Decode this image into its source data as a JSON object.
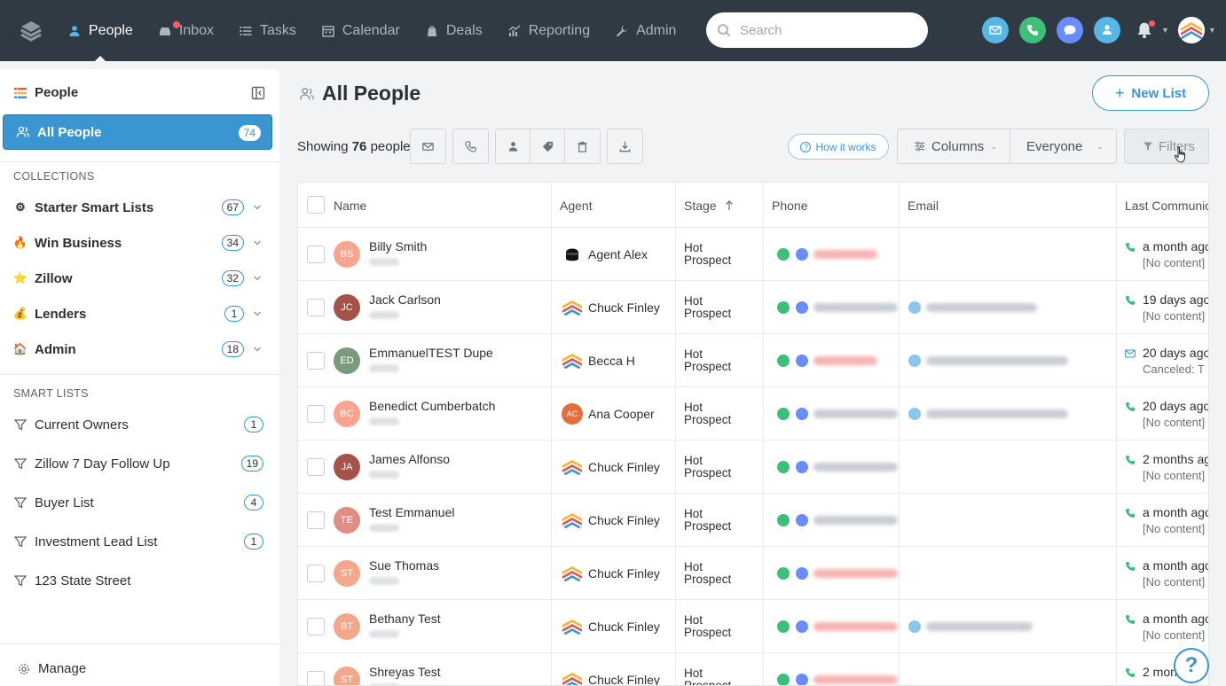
{
  "nav": {
    "items": [
      {
        "label": "People",
        "icon": "people-icon",
        "active": true
      },
      {
        "label": "Inbox",
        "icon": "inbox-icon",
        "active": false,
        "dot": true
      },
      {
        "label": "Tasks",
        "icon": "tasks-icon",
        "active": false
      },
      {
        "label": "Calendar",
        "icon": "calendar-icon",
        "active": false
      },
      {
        "label": "Deals",
        "icon": "deals-icon",
        "active": false
      },
      {
        "label": "Reporting",
        "icon": "reporting-icon",
        "active": false
      },
      {
        "label": "Admin",
        "icon": "wrench-icon",
        "active": false
      }
    ],
    "search_placeholder": "Search"
  },
  "sidebar": {
    "title": "People",
    "all_people": {
      "label": "All People",
      "count": "74"
    },
    "collections_heading": "COLLECTIONS",
    "collections": [
      {
        "label": "Starter Smart Lists",
        "count": "67",
        "emoji": "⚙"
      },
      {
        "label": "Win Business",
        "count": "34",
        "emoji": "🔥"
      },
      {
        "label": "Zillow",
        "count": "32",
        "emoji": "⭐"
      },
      {
        "label": "Lenders",
        "count": "1",
        "emoji": "💰"
      },
      {
        "label": "Admin",
        "count": "18",
        "emoji": "🏠"
      }
    ],
    "smart_lists_heading": "SMART LISTS",
    "smart_lists": [
      {
        "label": "Current Owners",
        "count": "1"
      },
      {
        "label": "Zillow 7 Day Follow Up",
        "count": "19"
      },
      {
        "label": "Buyer List",
        "count": "4"
      },
      {
        "label": "Investment Lead List",
        "count": "1"
      },
      {
        "label": "123 State Street",
        "count": ""
      }
    ],
    "manage_label": "Manage"
  },
  "main": {
    "title": "All People",
    "new_list_label": "New List",
    "showing_prefix": "Showing",
    "showing_count": "76",
    "showing_suffix": "people",
    "how_it_works": "How it works",
    "columns_label": "Columns",
    "everyone_label": "Everyone",
    "filters_label": "Filters",
    "help_label": "?"
  },
  "table": {
    "headers": {
      "name": "Name",
      "agent": "Agent",
      "stage": "Stage",
      "phone": "Phone",
      "email": "Email",
      "last": "Last Communic"
    },
    "rows": [
      {
        "initials": "BS",
        "name": "Billy Smith",
        "avatar_color": "#f7a58f",
        "agent": "Agent Alex",
        "agent_type": "dark",
        "stage1": "Hot",
        "stage2": "Prospect",
        "phone_color": "#f7b3b3",
        "phone_w": 72,
        "email": false,
        "lc_type": "phone",
        "lc_main": "a month ago",
        "lc_sub": "[No content]"
      },
      {
        "initials": "JC",
        "name": "Jack Carlson",
        "avatar_color": "#a5524b",
        "agent": "Chuck Finley",
        "agent_type": "logo",
        "stage1": "Hot",
        "stage2": "Prospect",
        "phone_color": "#c9cdd1",
        "phone_w": 95,
        "email": true,
        "email_w": 125,
        "lc_type": "phone",
        "lc_main": "19 days ago",
        "lc_sub": "[No content]"
      },
      {
        "initials": "ED",
        "name": "EmmanuelTEST Dupe",
        "avatar_color": "#7b9a7b",
        "agent": "Becca H",
        "agent_type": "logo",
        "stage1": "Hot",
        "stage2": "Prospect",
        "phone_color": "#f7b3b3",
        "phone_w": 72,
        "email": true,
        "email_w": 160,
        "lc_type": "email",
        "lc_main": "20 days ago",
        "lc_sub": "Canceled: T"
      },
      {
        "initials": "BC",
        "name": "Benedict Cumberbatch",
        "avatar_color": "#f7a58f",
        "agent": "Ana Cooper",
        "agent_type": "initials",
        "agent_initials": "AC",
        "stage1": "Hot",
        "stage2": "Prospect",
        "phone_color": "#c9cdd1",
        "phone_w": 95,
        "email": true,
        "email_w": 160,
        "lc_type": "phone",
        "lc_main": "20 days ago",
        "lc_sub": "[No content]"
      },
      {
        "initials": "JA",
        "name": "James Alfonso",
        "avatar_color": "#a5524b",
        "agent": "Chuck Finley",
        "agent_type": "logo",
        "stage1": "Hot",
        "stage2": "Prospect",
        "phone_color": "#c9cdd1",
        "phone_w": 95,
        "email": false,
        "lc_type": "phone",
        "lc_main": "2 months ag",
        "lc_sub": "[No content]"
      },
      {
        "initials": "TE",
        "name": "Test Emmanuel",
        "avatar_color": "#e08e84",
        "agent": "Chuck Finley",
        "agent_type": "logo",
        "stage1": "Hot",
        "stage2": "Prospect",
        "phone_color": "#c9cdd1",
        "phone_w": 95,
        "email": false,
        "lc_type": "phone",
        "lc_main": "a month ago",
        "lc_sub": "[No content]"
      },
      {
        "initials": "ST",
        "name": "Sue Thomas",
        "avatar_color": "#f3a88e",
        "agent": "Chuck Finley",
        "agent_type": "logo",
        "stage1": "Hot",
        "stage2": "Prospect",
        "phone_color": "#f7b3b3",
        "phone_w": 95,
        "email": false,
        "lc_type": "phone",
        "lc_main": "a month ago",
        "lc_sub": "[No content]"
      },
      {
        "initials": "BT",
        "name": "Bethany Test",
        "avatar_color": "#f3a88e",
        "agent": "Chuck Finley",
        "agent_type": "logo",
        "stage1": "Hot",
        "stage2": "Prospect",
        "phone_color": "#f7b3b3",
        "phone_w": 95,
        "email": true,
        "email_w": 120,
        "lc_type": "phone",
        "lc_main": "a month ago",
        "lc_sub": "[No content]"
      },
      {
        "initials": "ST",
        "name": "Shreyas Test",
        "avatar_color": "#f3a88e",
        "agent": "Chuck Finley",
        "agent_type": "logo",
        "stage1": "Hot",
        "stage2": "Prospect",
        "phone_color": "#f7b3b3",
        "phone_w": 95,
        "email": false,
        "lc_type": "phone",
        "lc_main": "2 mon",
        "lc_sub": ""
      }
    ]
  },
  "colors": {
    "accent": "#3b95d0",
    "nav_bg": "#2f3a44",
    "phone_green": "#3dbe79",
    "chat_blue": "#6b8cff"
  }
}
